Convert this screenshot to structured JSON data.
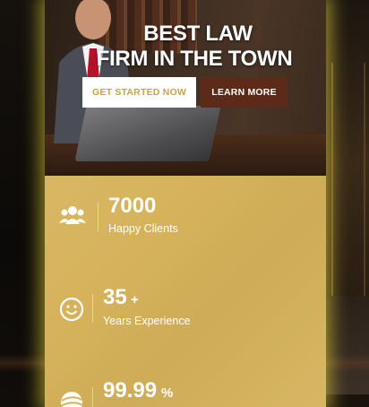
{
  "hero": {
    "title_line1": "BEST LAW",
    "title_line2": "FIRM IN THE TOWN",
    "get_started_label": "GET STARTED NOW",
    "learn_more_label": "LEARN MORE"
  },
  "stats": [
    {
      "icon": "users-icon",
      "number": "7000",
      "suffix": "",
      "label": "Happy Clients"
    },
    {
      "icon": "smiley-icon",
      "number": "35",
      "suffix": "+",
      "label": "Years Experience"
    },
    {
      "icon": "ball-icon",
      "number": "99.99",
      "suffix": "%",
      "label": ""
    }
  ],
  "colors": {
    "accent_gold": "#d6b35b",
    "button_brown": "#5c2a18",
    "glow": "#f0dc3c"
  }
}
